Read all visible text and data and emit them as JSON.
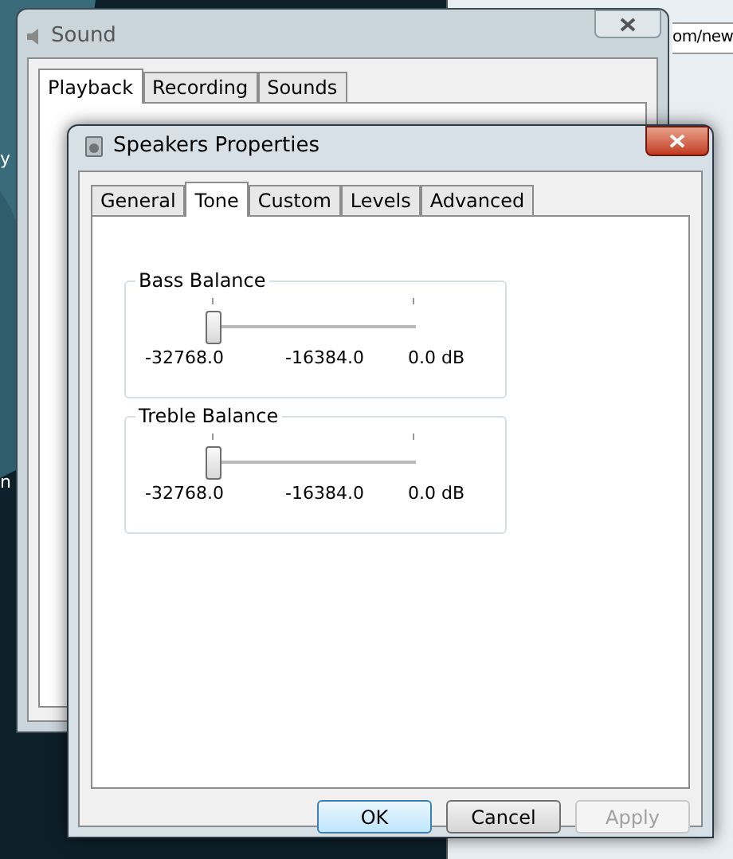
{
  "desktop": {
    "edge_texts": [
      "y",
      "n"
    ]
  },
  "browser": {
    "address": "om/new"
  },
  "sound_window": {
    "title": "Sound",
    "tabs": [
      {
        "label": "Playback",
        "selected": true
      },
      {
        "label": "Recording",
        "selected": false
      },
      {
        "label": "Sounds",
        "selected": false
      }
    ]
  },
  "properties_window": {
    "title": "Speakers Properties",
    "tabs": [
      {
        "label": "General",
        "selected": false
      },
      {
        "label": "Tone",
        "selected": true
      },
      {
        "label": "Custom",
        "selected": false
      },
      {
        "label": "Levels",
        "selected": false
      },
      {
        "label": "Advanced",
        "selected": false
      }
    ],
    "groups": [
      {
        "title": "Bass Balance",
        "level": 0,
        "ticks": [
          "-32768.0",
          "-16384.0",
          "0.0 dB"
        ]
      },
      {
        "title": "Treble Balance",
        "level": 0,
        "ticks": [
          "-32768.0",
          "-16384.0",
          "0.0 dB"
        ]
      }
    ],
    "buttons": [
      {
        "label": "OK",
        "kind": "default",
        "disabled": false
      },
      {
        "label": "Cancel",
        "kind": "normal",
        "disabled": false
      },
      {
        "label": "Apply",
        "kind": "normal",
        "disabled": true
      }
    ]
  }
}
